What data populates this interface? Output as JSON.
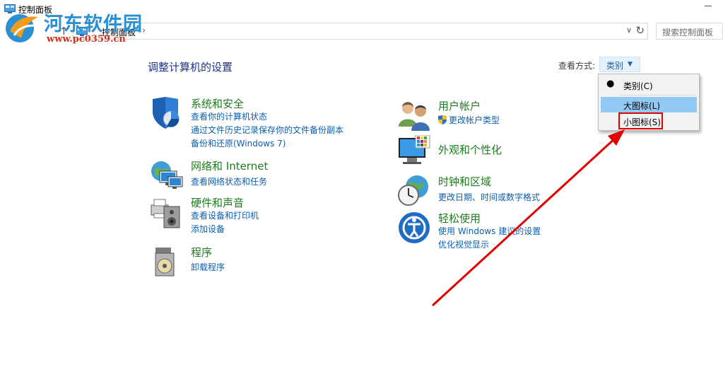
{
  "window": {
    "title": "控制面板"
  },
  "nav": {
    "address_text": "控制面板",
    "search_placeholder": "搜索控制面板"
  },
  "watermark": {
    "name": "河东软件园",
    "url": "www.pc0359.cn"
  },
  "main": {
    "title": "调整计算机的设置",
    "view_by_label": "查看方式:",
    "view_by_value": "类别"
  },
  "categories": [
    {
      "id": "security",
      "icon": "shield-icon",
      "title": "系统和安全",
      "links": [
        "查看你的计算机状态",
        "通过文件历史记录保存你的文件备份副本",
        "备份和还原(Windows 7)"
      ]
    },
    {
      "id": "network",
      "icon": "network-globe-icon",
      "title": "网络和 Internet",
      "links": [
        "查看网络状态和任务"
      ]
    },
    {
      "id": "hardware",
      "icon": "printer-speaker-icon",
      "title": "硬件和声音",
      "links": [
        "查看设备和打印机",
        "添加设备"
      ]
    },
    {
      "id": "programs",
      "icon": "programs-disc-icon",
      "title": "程序",
      "links": [
        "卸载程序"
      ]
    },
    {
      "id": "users",
      "icon": "users-icon",
      "title": "用户帐户",
      "links": [
        "更改帐户类型"
      ]
    },
    {
      "id": "appearance",
      "icon": "monitor-palette-icon",
      "title": "外观和个性化",
      "links": []
    },
    {
      "id": "clock",
      "icon": "clock-globe-icon",
      "title": "时钟和区域",
      "links": [
        "更改日期、时间或数字格式"
      ]
    },
    {
      "id": "ease",
      "icon": "ease-of-access-icon",
      "title": "轻松使用",
      "links": [
        "使用 Windows 建议的设置",
        "优化视觉显示"
      ]
    }
  ],
  "menu": {
    "items": [
      {
        "label": "类别(C)",
        "selected": true
      },
      {
        "label": "大图标(L)",
        "highlighted": true
      },
      {
        "label": "小图标(S)"
      }
    ]
  },
  "colors": {
    "link": "#0b5fb0",
    "category_title": "#1e7b1e",
    "annotation": "#e00000",
    "menu_highlight": "#91c9f7"
  }
}
